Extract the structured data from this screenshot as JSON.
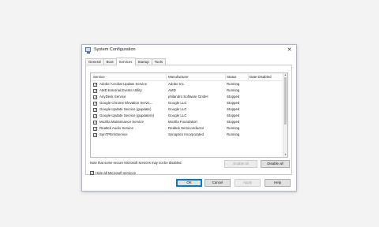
{
  "window": {
    "title": "System Configuration",
    "close_glyph": "✕"
  },
  "tabs": [
    "General",
    "Boot",
    "Services",
    "Startup",
    "Tools"
  ],
  "active_tab": "Services",
  "list": {
    "columns": [
      "Service",
      "Manufacturer",
      "Status",
      "Date Disabled"
    ],
    "rows": [
      {
        "checked": true,
        "service": "Adobe Acrobat Update Service",
        "manufacturer": "Adobe Inc.",
        "status": "Running",
        "date": ""
      },
      {
        "checked": true,
        "service": "AMD External Events Utility",
        "manufacturer": "AMD",
        "status": "Running",
        "date": ""
      },
      {
        "checked": true,
        "service": "AnyDesk Service",
        "manufacturer": "philandro Software GmbH",
        "status": "Stopped",
        "date": ""
      },
      {
        "checked": true,
        "service": "Google Chrome Elevation Servic...",
        "manufacturer": "Google LLC",
        "status": "Stopped",
        "date": ""
      },
      {
        "checked": true,
        "service": "Google Update Service (gupdate)",
        "manufacturer": "Google LLC",
        "status": "Stopped",
        "date": ""
      },
      {
        "checked": true,
        "service": "Google Update Service (gupdatem)",
        "manufacturer": "Google LLC",
        "status": "Stopped",
        "date": ""
      },
      {
        "checked": true,
        "service": "Mozilla Maintenance Service",
        "manufacturer": "Mozilla Foundation",
        "status": "Stopped",
        "date": ""
      },
      {
        "checked": true,
        "service": "Realtek Audio Service",
        "manufacturer": "Realtek Semiconductor",
        "status": "Running",
        "date": ""
      },
      {
        "checked": true,
        "service": "SynTPEnhService",
        "manufacturer": "Synaptics Incorporated",
        "status": "Running",
        "date": ""
      }
    ]
  },
  "note": "Note that some secure Microsoft services may not be disabled.",
  "buttons": {
    "enable_all": "Enable all",
    "disable_all": "Disable all",
    "ok": "OK",
    "cancel": "Cancel",
    "apply": "Apply",
    "help": "Help"
  },
  "hide_ms": {
    "label": "Hide all Microsoft services",
    "checked": true
  },
  "accent": "#0078d7"
}
